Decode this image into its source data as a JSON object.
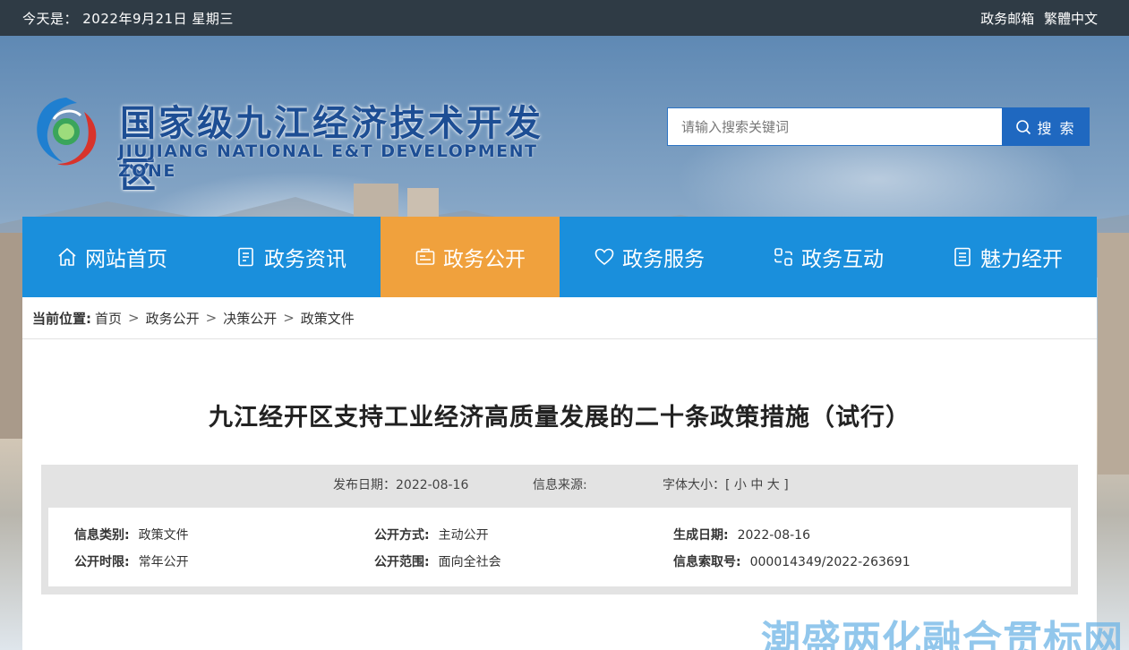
{
  "topbar": {
    "date_text": "今天是： 2022年9月21日 星期三",
    "mailbox_link": "政务邮箱",
    "traditional_link": "繁體中文"
  },
  "logo": {
    "title": "国家级九江经济技术开发区",
    "subtitle": "JIUJIANG NATIONAL E&T DEVELOPMENT ZONE"
  },
  "search": {
    "placeholder": "请输入搜索关键词",
    "button_label": "搜 索"
  },
  "nav": {
    "items": [
      {
        "label": "网站首页",
        "icon": "home-icon"
      },
      {
        "label": "政务资讯",
        "icon": "document-icon"
      },
      {
        "label": "政务公开",
        "icon": "notice-icon",
        "active": true
      },
      {
        "label": "政务服务",
        "icon": "heart-icon"
      },
      {
        "label": "政务互动",
        "icon": "interaction-icon"
      },
      {
        "label": "魅力经开",
        "icon": "list-icon"
      }
    ],
    "colors": {
      "bar": "#1a8fdc",
      "active": "#f0a13d"
    }
  },
  "breadcrumb": {
    "label": "当前位置:",
    "items": [
      "首页",
      "政务公开",
      "决策公开",
      "政策文件"
    ],
    "separator": ">"
  },
  "article": {
    "title": "九江经开区支持工业经济高质量发展的二十条政策措施（试行）",
    "publish_date_label": "发布日期：2022-08-16",
    "source_label": "信息来源:",
    "font_size_label": "字体大小：[ 小 中 大 ]"
  },
  "info": {
    "category_key": "信息类别:",
    "category_value": "政策文件",
    "method_key": "公开方式:",
    "method_value": "主动公开",
    "gen_date_key": "生成日期:",
    "gen_date_value": "2022-08-16",
    "period_key": "公开时限:",
    "period_value": "常年公开",
    "scope_key": "公开范围:",
    "scope_value": "面向全社会",
    "index_key": "信息索取号:",
    "index_value": "000014349/2022-263691"
  },
  "watermark": "潮盛两化融合贯标网"
}
